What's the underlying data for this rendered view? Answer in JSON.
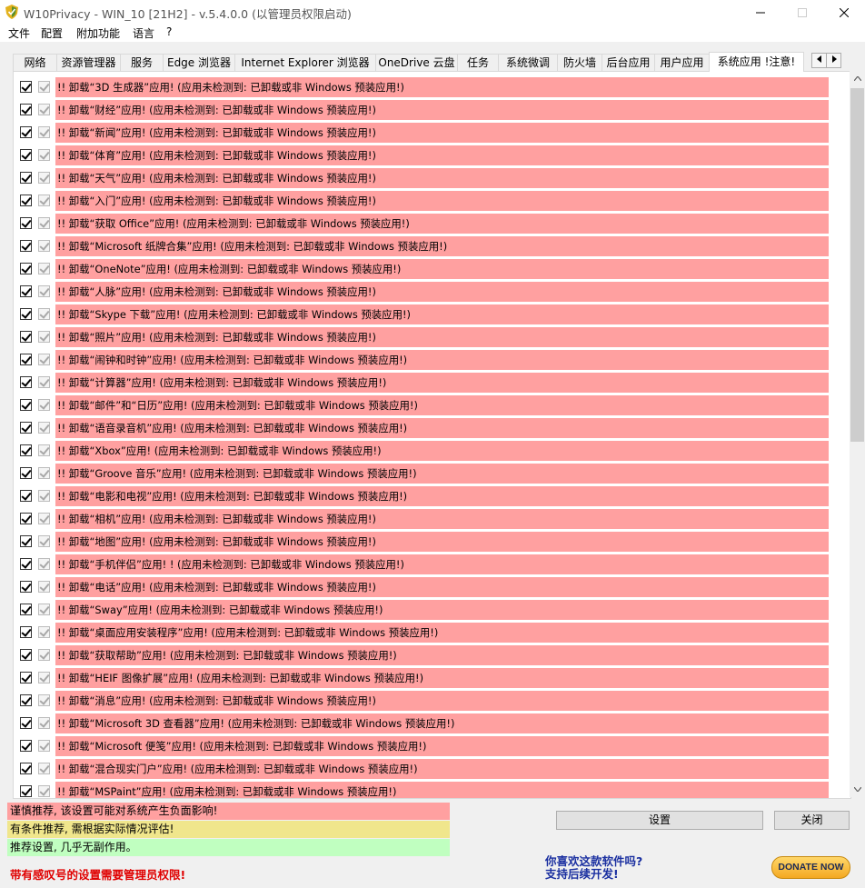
{
  "window": {
    "title": "W10Privacy - WIN_10 [21H2]  - v.5.4.0.0 (以管理员权限启动)",
    "minimize_icon": "minimize-icon",
    "maximize_icon": "maximize-icon",
    "close_icon": "close-icon"
  },
  "menu": [
    "文件",
    "配置",
    "附加功能",
    "语言",
    "?"
  ],
  "tabs": [
    "网络",
    "资源管理器",
    "服务",
    "Edge 浏览器",
    "Internet Explorer 浏览器",
    "OneDrive 云盘",
    "任务",
    "系统微调",
    "防火墙",
    "后台应用",
    "用户应用",
    "系统应用 !注意!"
  ],
  "active_tab_index": 11,
  "colors": {
    "not_recommended": "#ffa0a0",
    "conditional": "#f0e68c",
    "recommended": "#c0ffc0",
    "warning_text": "#e00000",
    "promo_text": "#1a2fa0"
  },
  "rows": [
    "!! 卸载“3D 生成器”应用! (应用未检测到: 已卸载或非 Windows 预装应用!)",
    "!! 卸载“财经”应用! (应用未检测到: 已卸载或非 Windows 预装应用!)",
    "!! 卸载“新闻”应用! (应用未检测到: 已卸载或非 Windows 预装应用!)",
    "!! 卸载“体育”应用! (应用未检测到: 已卸载或非 Windows 预装应用!)",
    "!! 卸载“天气”应用! (应用未检测到: 已卸载或非 Windows 预装应用!)",
    "!! 卸载“入门”应用! (应用未检测到: 已卸载或非 Windows 预装应用!)",
    "!! 卸载“获取 Office”应用! (应用未检测到: 已卸载或非 Windows 预装应用!)",
    "!! 卸载“Microsoft 纸牌合集”应用! (应用未检测到: 已卸载或非 Windows 预装应用!)",
    "!! 卸载“OneNote”应用! (应用未检测到: 已卸载或非 Windows 预装应用!)",
    "!! 卸载“人脉”应用! (应用未检测到: 已卸载或非 Windows 预装应用!)",
    "!! 卸载“Skype 下载”应用! (应用未检测到: 已卸载或非 Windows 预装应用!)",
    "!! 卸载“照片”应用! (应用未检测到: 已卸载或非 Windows 预装应用!)",
    "!! 卸载“闹钟和时钟”应用! (应用未检测到: 已卸载或非 Windows 预装应用!)",
    "!! 卸载“计算器”应用! (应用未检测到: 已卸载或非 Windows 预装应用!)",
    "!! 卸载“邮件”和“日历”应用! (应用未检测到: 已卸载或非 Windows 预装应用!)",
    "!! 卸载“语音录音机”应用! (应用未检测到: 已卸载或非 Windows 预装应用!)",
    "!! 卸载“Xbox”应用! (应用未检测到: 已卸载或非 Windows 预装应用!)",
    "!! 卸载“Groove 音乐”应用! (应用未检测到: 已卸载或非 Windows 预装应用!)",
    "!! 卸载“电影和电视”应用! (应用未检测到: 已卸载或非 Windows 预装应用!)",
    "!! 卸载“相机”应用! (应用未检测到: 已卸载或非 Windows 预装应用!)",
    "!! 卸载“地图”应用! (应用未检测到: 已卸载或非 Windows 预装应用!)",
    "!! 卸载“手机伴侣”应用! ! (应用未检测到: 已卸载或非 Windows 预装应用!)",
    "!! 卸载“电话”应用! (应用未检测到: 已卸载或非 Windows 预装应用!)",
    "!! 卸载“Sway”应用! (应用未检测到: 已卸载或非 Windows 预装应用!)",
    "!! 卸载“桌面应用安装程序”应用! (应用未检测到: 已卸载或非 Windows 预装应用!)",
    "!! 卸载“获取帮助”应用! (应用未检测到: 已卸载或非 Windows 预装应用!)",
    "!! 卸载“HEIF 图像扩展”应用! (应用未检测到: 已卸载或非 Windows 预装应用!)",
    "!! 卸载“消息”应用! (应用未检测到: 已卸载或非 Windows 预装应用!)",
    "!! 卸载“Microsoft 3D 查看器”应用! (应用未检测到: 已卸载或非 Windows 预装应用!)",
    "!! 卸载“Microsoft 便笺”应用! (应用未检测到: 已卸载或非 Windows 预装应用!)",
    "!! 卸载“混合现实门户”应用! (应用未检测到: 已卸载或非 Windows 预装应用!)",
    "!! 卸载“MSPaint”应用! (应用未检测到: 已卸载或非 Windows 预装应用!)"
  ],
  "legend": {
    "not_recommended": "谨慎推荐, 该设置可能对系统产生负面影响!",
    "conditional": "有条件推荐, 需根据实际情况评估!",
    "recommended": "推荐设置, 几乎无副作用。"
  },
  "buttons": {
    "apply": "设置",
    "close": "关闭"
  },
  "warning": "带有感叹号的设置需要管理员权限!",
  "promo": {
    "line1": "你喜欢这款软件吗?",
    "line2": "支持后续开发!"
  },
  "donate": "DONATE NOW"
}
